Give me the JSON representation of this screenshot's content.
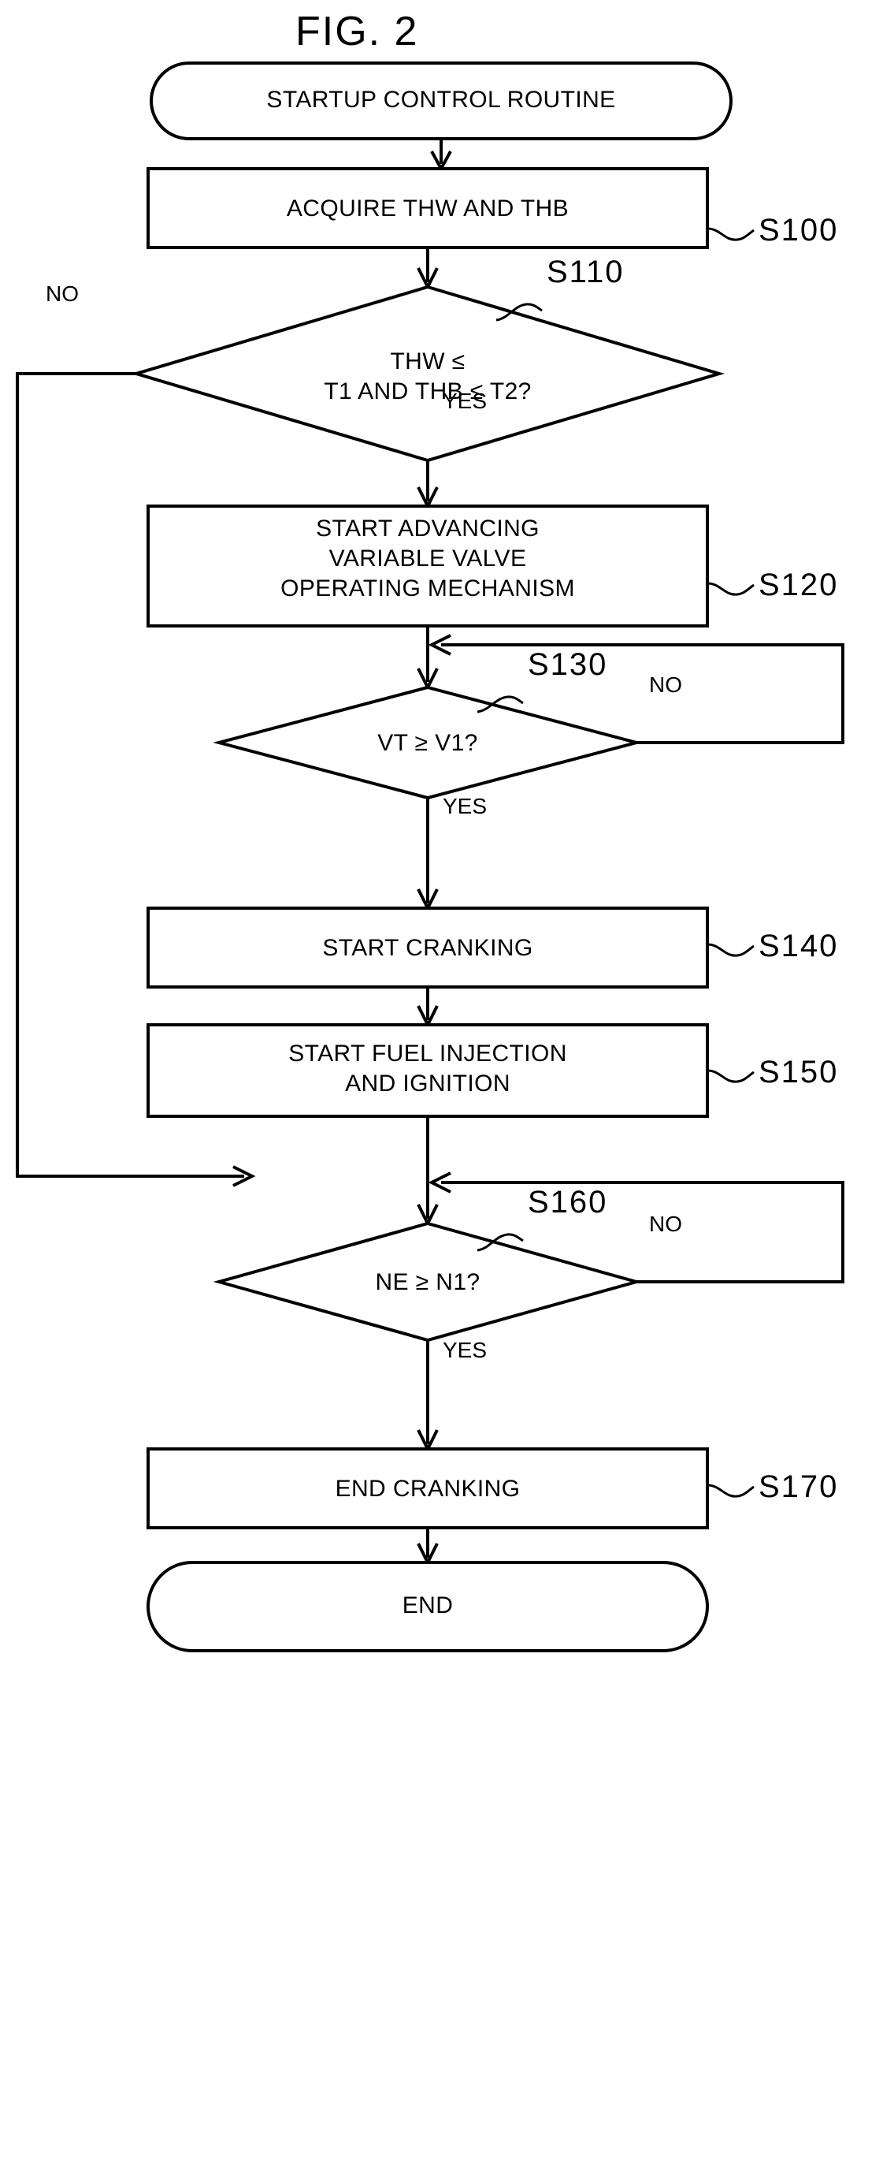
{
  "figure": {
    "title": "FIG. 2",
    "type": "flowchart",
    "caption_position": "top-center"
  },
  "nodes": [
    {
      "id": "start",
      "shape": "terminator",
      "lines": [
        "STARTUP CONTROL ROUTINE"
      ],
      "step_label": ""
    },
    {
      "id": "s100",
      "shape": "process",
      "lines": [
        "ACQUIRE THW AND THB"
      ],
      "step_label": "S100"
    },
    {
      "id": "s110",
      "shape": "decision",
      "lines": [
        "THW ≤",
        "T1 AND THB ≤ T2?"
      ],
      "step_label": "S110",
      "yes_label": "YES",
      "no_label": "NO"
    },
    {
      "id": "s120",
      "shape": "process",
      "lines": [
        "START ADVANCING",
        "VARIABLE VALVE",
        "OPERATING MECHANISM"
      ],
      "step_label": "S120"
    },
    {
      "id": "s130",
      "shape": "decision",
      "lines": [
        "VT ≥ V1?"
      ],
      "step_label": "S130",
      "yes_label": "YES",
      "no_label": "NO"
    },
    {
      "id": "s140",
      "shape": "process",
      "lines": [
        "START CRANKING"
      ],
      "step_label": "S140"
    },
    {
      "id": "s150",
      "shape": "process",
      "lines": [
        "START FUEL INJECTION",
        "AND IGNITION"
      ],
      "step_label": "S150"
    },
    {
      "id": "s160",
      "shape": "decision",
      "lines": [
        "NE ≥ N1?"
      ],
      "step_label": "S160",
      "yes_label": "YES",
      "no_label": "NO"
    },
    {
      "id": "s170",
      "shape": "process",
      "lines": [
        "END CRANKING"
      ],
      "step_label": "S170"
    },
    {
      "id": "end",
      "shape": "terminator",
      "lines": [
        "END"
      ],
      "step_label": ""
    }
  ],
  "labels": {
    "title": "FIG. 2",
    "start_text": "STARTUP CONTROL ROUTINE",
    "s100_text": "ACQUIRE THW AND THB",
    "s100_step": "S100",
    "s110_line1": "THW ≤",
    "s110_line2": "T1 AND THB ≤ T2?",
    "s110_step": "S110",
    "s110_no": "NO",
    "s110_yes": "YES",
    "s120_line1": "START ADVANCING",
    "s120_line2": "VARIABLE VALVE",
    "s120_line3": "OPERATING MECHANISM",
    "s120_step": "S120",
    "s130_text": "VT ≥ V1?",
    "s130_step": "S130",
    "s130_no": "NO",
    "s130_yes": "YES",
    "s140_text": "START CRANKING",
    "s140_step": "S140",
    "s150_line1": "START FUEL INJECTION",
    "s150_line2": "AND IGNITION",
    "s150_step": "S150",
    "s160_text": "NE ≥ N1?",
    "s160_step": "S160",
    "s160_no": "NO",
    "s160_yes": "YES",
    "s170_text": "END CRANKING",
    "s170_step": "S170",
    "end_text": "END"
  },
  "colors": {
    "stroke": "#000000",
    "fill": "#ffffff",
    "text": "#000000"
  }
}
